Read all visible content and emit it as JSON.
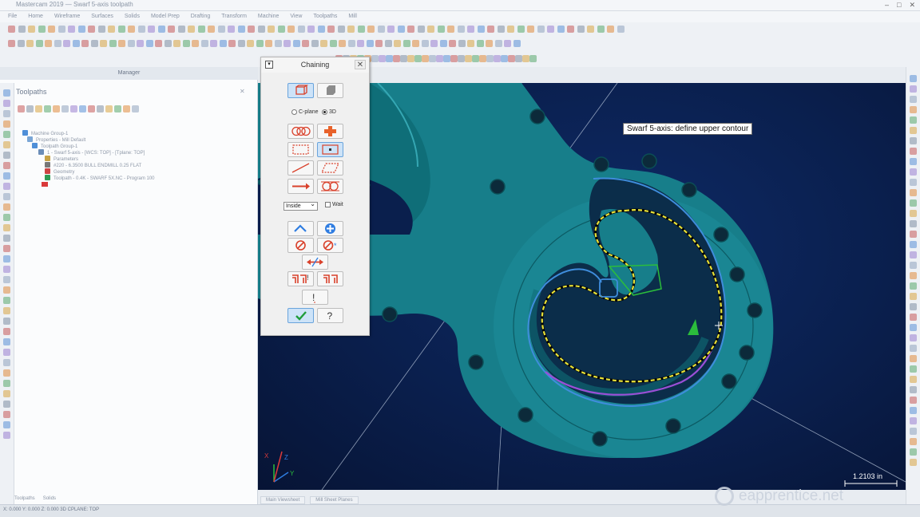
{
  "window": {
    "title": "Mastercam 2019 — Swarf 5-axis toolpath",
    "controls": [
      "–",
      "□",
      "✕"
    ]
  },
  "menu": [
    "File",
    "Home",
    "Wireframe",
    "Surfaces",
    "Solids",
    "Model Prep",
    "Drafting",
    "Transform",
    "Machine",
    "View",
    "Toolpaths",
    "Mill"
  ],
  "left_panel": {
    "header": "Manager",
    "title": "Toolpaths",
    "close": "✕",
    "tree": [
      "Machine Group-1",
      "Properties - Mill Default",
      "Toolpath Group-1",
      "1 - Swarf 5-axis - [WCS: TOP] - [Tplane: TOP]",
      "Parameters",
      "#220 - 6.3500 BULL ENDMILL 0.25 FLAT",
      "Geometry",
      "Toolpath - 0.4K - SWARF 5X.NC - Program 100"
    ],
    "bottom_tabs": [
      "Toolpaths",
      "Solids"
    ]
  },
  "chaining": {
    "title": "Chaining",
    "pin": "▾",
    "close": "✕",
    "cplane_label": "C-plane",
    "threed_label": "3D",
    "mode_select": "Inside",
    "wait_label": "Wait"
  },
  "viewport": {
    "tooltip": "Swarf 5-axis: define upper contour",
    "scale": "1.2103 in",
    "axis": [
      "X",
      "Z",
      "Y"
    ]
  },
  "view_tabs": [
    "Main Viewsheet",
    "Mill Sheet Planes"
  ],
  "status": {
    "left": "X: 0.000  Y: 0.000  Z: 0.000  3D  CPLANE: TOP"
  },
  "watermark": "eapprentice.net",
  "colors": {
    "part": "#177e8a",
    "part_dark": "#0c5a63",
    "viewport_bg": "#0a1f4d",
    "upper_chain": "#e8e23a",
    "lower_contour": "#3f8ddc",
    "selected_edge": "#9a4fd6",
    "chain_marker": "#2bbd3c"
  }
}
